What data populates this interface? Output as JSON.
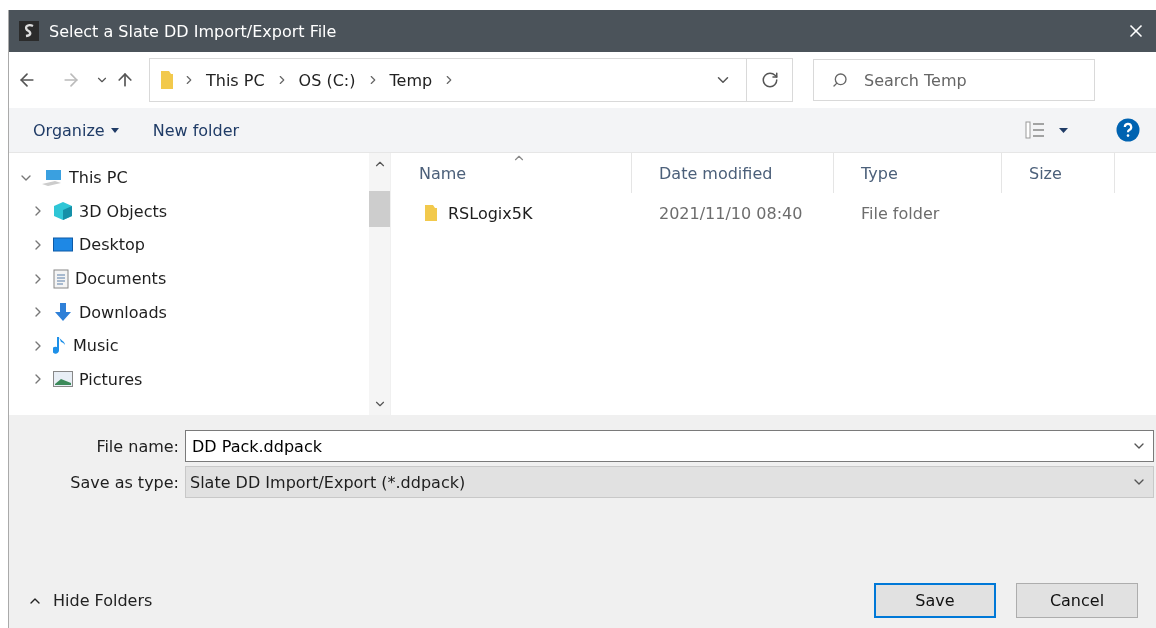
{
  "window": {
    "title": "Select a Slate DD Import/Export File"
  },
  "address_bar": {
    "path": [
      "This PC",
      "OS (C:)",
      "Temp"
    ]
  },
  "search": {
    "placeholder": "Search Temp"
  },
  "toolbar": {
    "organize": "Organize",
    "new_folder": "New folder"
  },
  "tree": [
    {
      "label": "This PC",
      "kind": "pc",
      "expanded": true,
      "children": [
        {
          "label": "3D Objects",
          "kind": "cube",
          "expanded": false
        },
        {
          "label": "Desktop",
          "kind": "desktop",
          "expanded": false
        },
        {
          "label": "Documents",
          "kind": "documents",
          "expanded": false
        },
        {
          "label": "Downloads",
          "kind": "downloads",
          "expanded": false
        },
        {
          "label": "Music",
          "kind": "music",
          "expanded": false
        },
        {
          "label": "Pictures",
          "kind": "pictures",
          "expanded": false
        }
      ]
    }
  ],
  "columns": [
    {
      "label": "Name",
      "sorted": true
    },
    {
      "label": "Date modified",
      "sorted": false
    },
    {
      "label": "Type",
      "sorted": false
    },
    {
      "label": "Size",
      "sorted": false
    }
  ],
  "files": [
    {
      "name": "RSLogix5K",
      "date_modified": "2021/11/10 08:40",
      "type": "File folder"
    }
  ],
  "file_name": {
    "label": "File name:",
    "value": "DD Pack.ddpack"
  },
  "save_as_type": {
    "label": "Save as type:",
    "value": "Slate DD Import/Export (*.ddpack)"
  },
  "hide_folders": "Hide Folders",
  "buttons": [
    {
      "label": "Save",
      "default": true
    },
    {
      "label": "Cancel",
      "default": false
    }
  ]
}
